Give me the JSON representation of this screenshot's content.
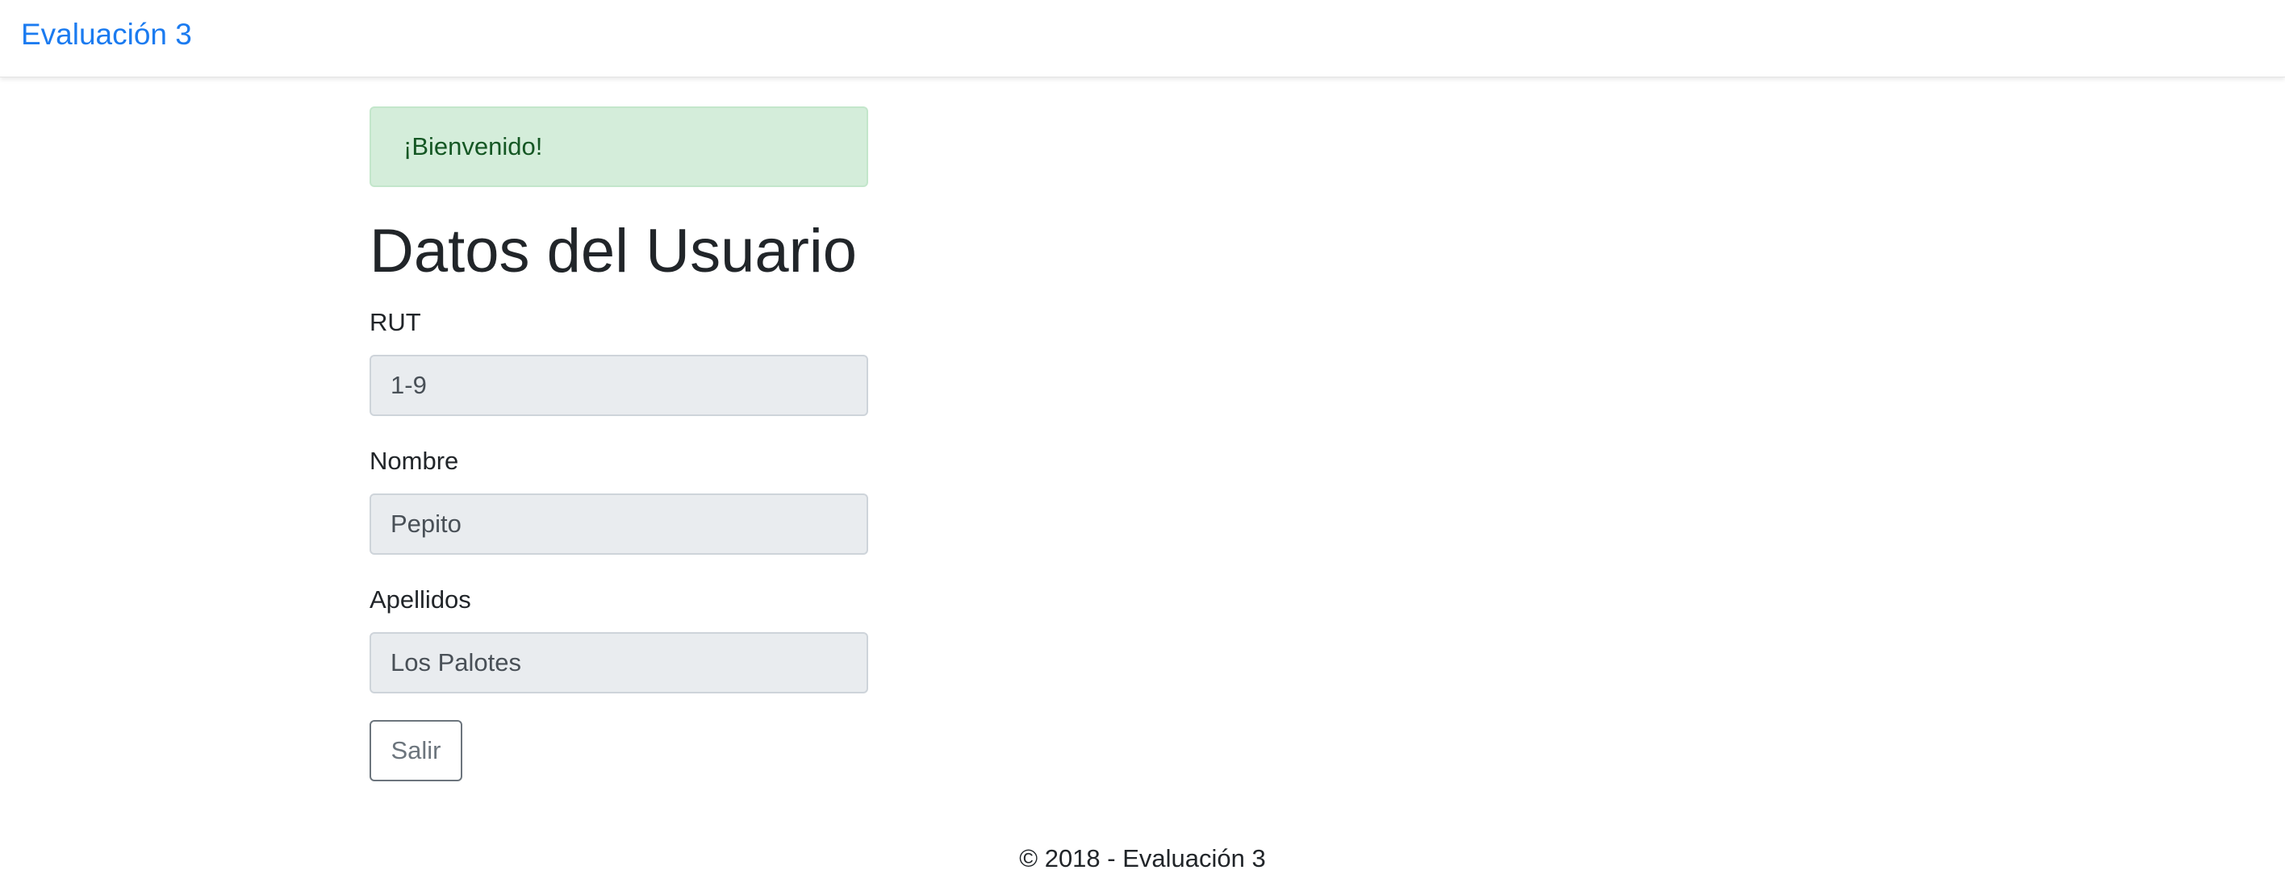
{
  "navbar": {
    "brand": "Evaluación 3"
  },
  "alert": {
    "message": "¡Bienvenido!"
  },
  "main": {
    "title": "Datos del Usuario",
    "fields": [
      {
        "label": "RUT",
        "value": "1-9"
      },
      {
        "label": "Nombre",
        "value": "Pepito"
      },
      {
        "label": "Apellidos",
        "value": "Los Palotes"
      }
    ],
    "exit_button": "Salir"
  },
  "footer": {
    "text": "© 2018 - Evaluación 3"
  },
  "colors": {
    "brand": "#1b7bf0",
    "alert_bg": "#d4edda",
    "alert_text": "#155724",
    "input_bg": "#e9ecef",
    "button_border": "#6c757d"
  }
}
